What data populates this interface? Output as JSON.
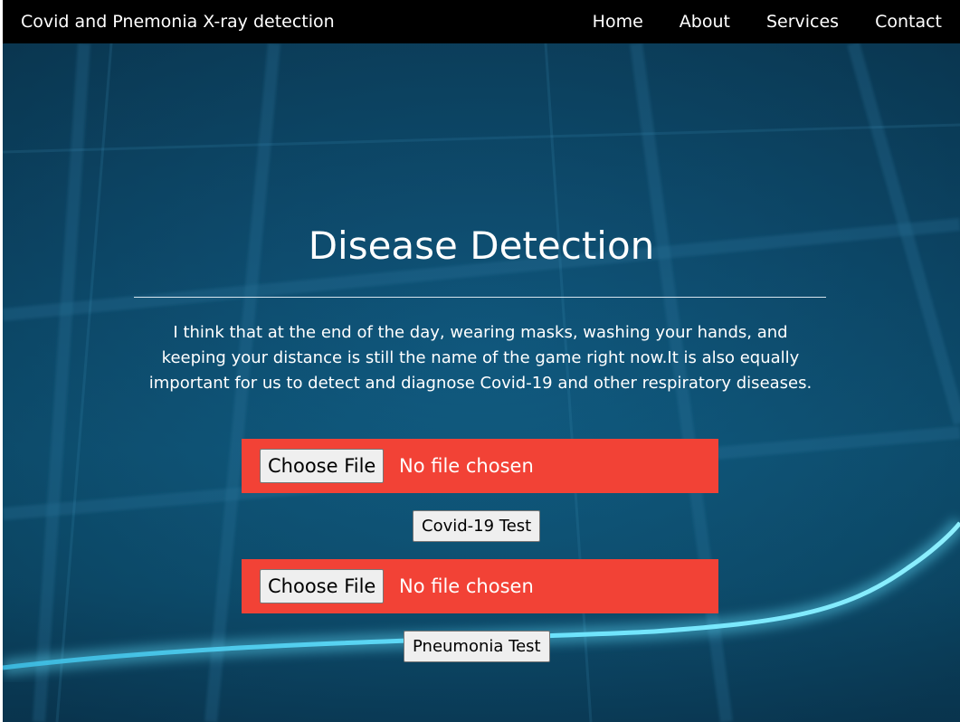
{
  "navbar": {
    "brand": "Covid and Pnemonia X-ray detection",
    "links": [
      "Home",
      "About",
      "Services",
      "Contact"
    ]
  },
  "hero": {
    "title": "Disease Detection",
    "description": "I think that at the end of the day, wearing masks, washing your hands, and keeping your distance is still the name of the game right now.It is also equally important for us to detect and diagnose Covid-19 and other respiratory diseases."
  },
  "covid_upload": {
    "choose_label": "Choose File",
    "status": "No file chosen",
    "submit_label": "Covid-19 Test"
  },
  "pneumonia_upload": {
    "choose_label": "Choose File",
    "status": "No file chosen",
    "submit_label": "Pneumonia Test"
  },
  "colors": {
    "navbar": "#000000",
    "hero_background": "#0d4a6c",
    "upload_box": "#f24236",
    "glow_line": "#5fd8f5"
  }
}
